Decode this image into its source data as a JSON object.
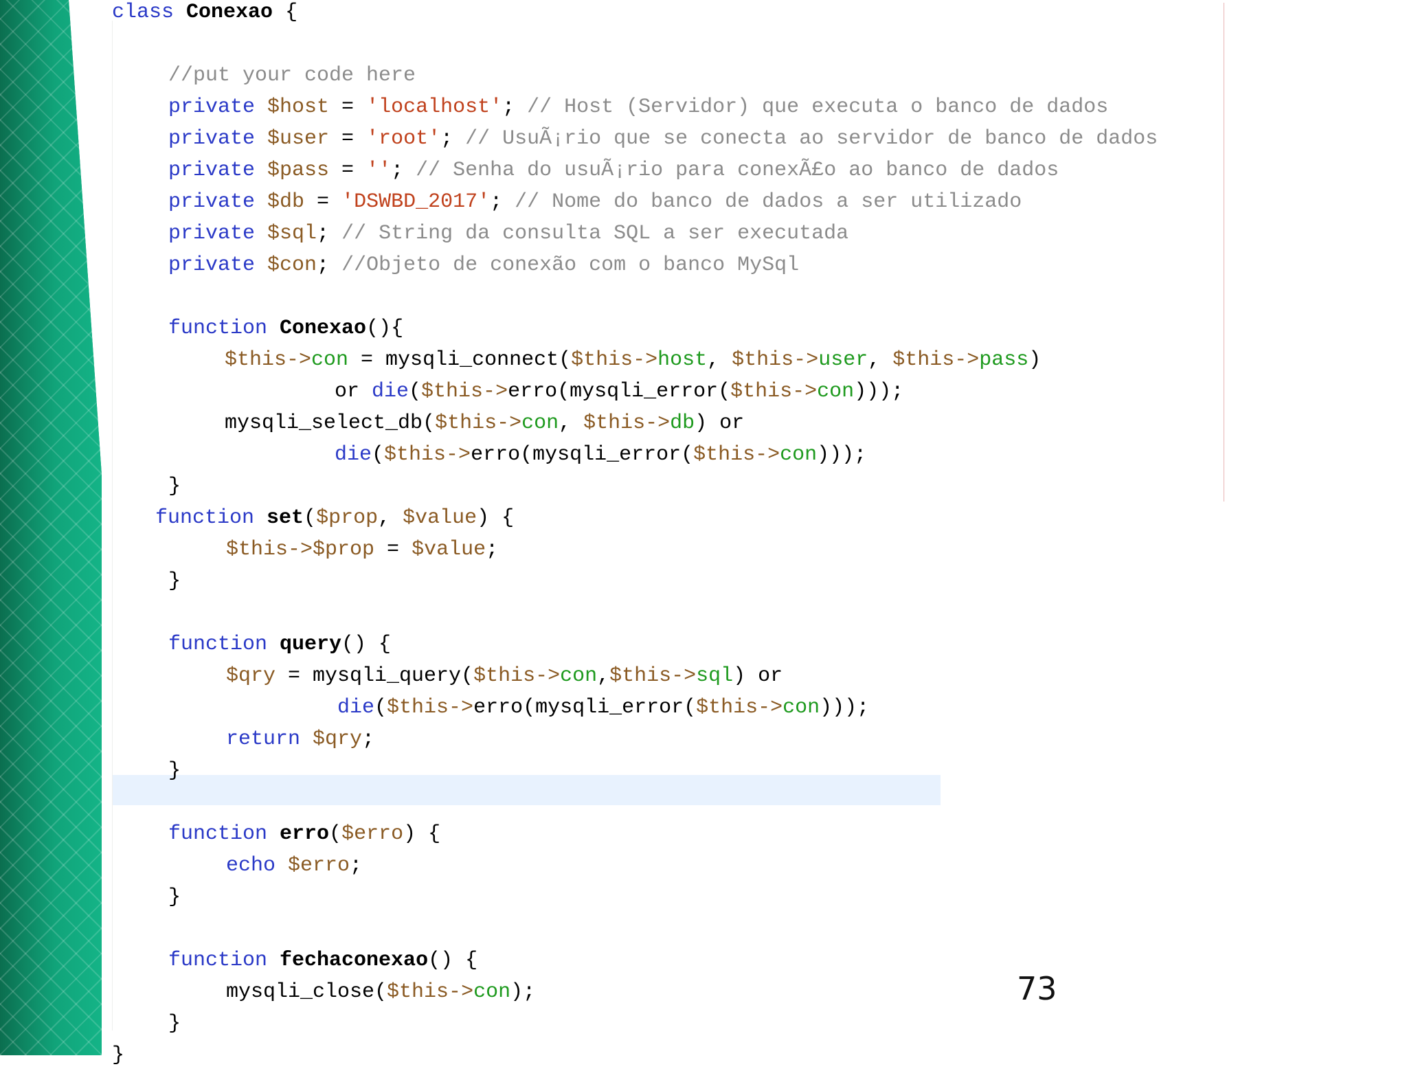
{
  "slide_number": "73",
  "colors": {
    "keyword": "#2a39c7",
    "variable": "#8a5a23",
    "string": "#c0411c",
    "property": "#1e9a1e",
    "comment": "#8b8b8b",
    "background_band": "#0f8a63"
  },
  "code_lines": [
    [
      {
        "t": "kw",
        "v": "class "
      },
      {
        "t": "ty",
        "v": "Conexao"
      },
      {
        "t": "pl",
        "v": " {"
      }
    ],
    [],
    [
      {
        "t": "cm",
        "v": "//put your code here"
      }
    ],
    [
      {
        "t": "kw",
        "v": "private "
      },
      {
        "t": "vr",
        "v": "$host"
      },
      {
        "t": "pl",
        "v": " = "
      },
      {
        "t": "st",
        "v": "'localhost'"
      },
      {
        "t": "pl",
        "v": "; "
      },
      {
        "t": "cm",
        "v": "// Host (Servidor) que executa o banco de dados"
      }
    ],
    [
      {
        "t": "kw",
        "v": "private "
      },
      {
        "t": "vr",
        "v": "$user"
      },
      {
        "t": "pl",
        "v": " = "
      },
      {
        "t": "st",
        "v": "'root'"
      },
      {
        "t": "pl",
        "v": "; "
      },
      {
        "t": "cm",
        "v": "// UsuÃ¡rio que se conecta ao servidor de banco de dados"
      }
    ],
    [
      {
        "t": "kw",
        "v": "private "
      },
      {
        "t": "vr",
        "v": "$pass"
      },
      {
        "t": "pl",
        "v": " = "
      },
      {
        "t": "st",
        "v": "''"
      },
      {
        "t": "pl",
        "v": "; "
      },
      {
        "t": "cm",
        "v": "// Senha do usuÃ¡rio para conexÃ£o ao banco de dados"
      }
    ],
    [
      {
        "t": "kw",
        "v": "private "
      },
      {
        "t": "vr",
        "v": "$db"
      },
      {
        "t": "pl",
        "v": " = "
      },
      {
        "t": "st",
        "v": "'DSWBD_2017'"
      },
      {
        "t": "pl",
        "v": "; "
      },
      {
        "t": "cm",
        "v": "// Nome do banco de dados a ser utilizado"
      }
    ],
    [
      {
        "t": "kw",
        "v": "private "
      },
      {
        "t": "vr",
        "v": "$sql"
      },
      {
        "t": "pl",
        "v": "; "
      },
      {
        "t": "cm",
        "v": "// String da consulta SQL a ser executada"
      }
    ],
    [
      {
        "t": "kw",
        "v": "private "
      },
      {
        "t": "vr",
        "v": "$con"
      },
      {
        "t": "pl",
        "v": "; "
      },
      {
        "t": "cm",
        "v": "//Objeto de conexão com o banco MySql"
      }
    ],
    [],
    [
      {
        "t": "kw",
        "v": "function "
      },
      {
        "t": "ty",
        "v": "Conexao"
      },
      {
        "t": "pl",
        "v": "(){"
      }
    ],
    [
      {
        "t": "vr",
        "v": "$this->"
      },
      {
        "t": "pr",
        "v": "con"
      },
      {
        "t": "pl",
        "v": " = mysqli_connect("
      },
      {
        "t": "vr",
        "v": "$this->"
      },
      {
        "t": "pr",
        "v": "host"
      },
      {
        "t": "pl",
        "v": ", "
      },
      {
        "t": "vr",
        "v": "$this->"
      },
      {
        "t": "pr",
        "v": "user"
      },
      {
        "t": "pl",
        "v": ", "
      },
      {
        "t": "vr",
        "v": "$this->"
      },
      {
        "t": "pr",
        "v": "pass"
      },
      {
        "t": "pl",
        "v": ")"
      }
    ],
    [
      {
        "t": "pl",
        "v": "or "
      },
      {
        "t": "kw",
        "v": "die"
      },
      {
        "t": "pl",
        "v": "("
      },
      {
        "t": "vr",
        "v": "$this->"
      },
      {
        "t": "pl",
        "v": "erro(mysqli_error("
      },
      {
        "t": "vr",
        "v": "$this->"
      },
      {
        "t": "pr",
        "v": "con"
      },
      {
        "t": "pl",
        "v": ")));"
      }
    ],
    [
      {
        "t": "pl",
        "v": "mysqli_select_db("
      },
      {
        "t": "vr",
        "v": "$this->"
      },
      {
        "t": "pr",
        "v": "con"
      },
      {
        "t": "pl",
        "v": ", "
      },
      {
        "t": "vr",
        "v": "$this->"
      },
      {
        "t": "pr",
        "v": "db"
      },
      {
        "t": "pl",
        "v": ") or"
      }
    ],
    [
      {
        "t": "kw",
        "v": "die"
      },
      {
        "t": "pl",
        "v": "("
      },
      {
        "t": "vr",
        "v": "$this->"
      },
      {
        "t": "pl",
        "v": "erro(mysqli_error("
      },
      {
        "t": "vr",
        "v": "$this->"
      },
      {
        "t": "pr",
        "v": "con"
      },
      {
        "t": "pl",
        "v": ")));"
      }
    ],
    [
      {
        "t": "pl",
        "v": "}"
      }
    ],
    [
      {
        "t": "kw",
        "v": "function "
      },
      {
        "t": "ty",
        "v": "set"
      },
      {
        "t": "pl",
        "v": "("
      },
      {
        "t": "vr",
        "v": "$prop"
      },
      {
        "t": "pl",
        "v": ", "
      },
      {
        "t": "vr",
        "v": "$value"
      },
      {
        "t": "pl",
        "v": ") {"
      }
    ],
    [
      {
        "t": "vr",
        "v": "$this->$prop"
      },
      {
        "t": "pl",
        "v": " = "
      },
      {
        "t": "vr",
        "v": "$value"
      },
      {
        "t": "pl",
        "v": ";"
      }
    ],
    [
      {
        "t": "pl",
        "v": "}"
      }
    ],
    [],
    [
      {
        "t": "kw",
        "v": "function "
      },
      {
        "t": "ty",
        "v": "query"
      },
      {
        "t": "pl",
        "v": "() {"
      }
    ],
    [
      {
        "t": "vr",
        "v": "$qry"
      },
      {
        "t": "pl",
        "v": " = mysqli_query("
      },
      {
        "t": "vr",
        "v": "$this->"
      },
      {
        "t": "pr",
        "v": "con"
      },
      {
        "t": "pl",
        "v": ","
      },
      {
        "t": "vr",
        "v": "$this->"
      },
      {
        "t": "pr",
        "v": "sql"
      },
      {
        "t": "pl",
        "v": ") or"
      }
    ],
    [
      {
        "t": "kw",
        "v": "die"
      },
      {
        "t": "pl",
        "v": "("
      },
      {
        "t": "vr",
        "v": "$this->"
      },
      {
        "t": "pl",
        "v": "erro(mysqli_error("
      },
      {
        "t": "vr",
        "v": "$this->"
      },
      {
        "t": "pr",
        "v": "con"
      },
      {
        "t": "pl",
        "v": ")));"
      }
    ],
    [
      {
        "t": "kw",
        "v": "return "
      },
      {
        "t": "vr",
        "v": "$qry"
      },
      {
        "t": "pl",
        "v": ";"
      }
    ],
    [
      {
        "t": "pl",
        "v": "}"
      }
    ],
    [],
    [
      {
        "t": "kw",
        "v": "function "
      },
      {
        "t": "ty",
        "v": "erro"
      },
      {
        "t": "pl",
        "v": "("
      },
      {
        "t": "vr",
        "v": "$erro"
      },
      {
        "t": "pl",
        "v": ") {"
      }
    ],
    [
      {
        "t": "kw",
        "v": "echo "
      },
      {
        "t": "vr",
        "v": "$erro"
      },
      {
        "t": "pl",
        "v": ";"
      }
    ],
    [
      {
        "t": "pl",
        "v": "}"
      }
    ],
    [],
    [
      {
        "t": "kw",
        "v": "function "
      },
      {
        "t": "ty",
        "v": "fechaconexao"
      },
      {
        "t": "pl",
        "v": "() {"
      }
    ],
    [
      {
        "t": "pl",
        "v": "mysqli_close("
      },
      {
        "t": "vr",
        "v": "$this->"
      },
      {
        "t": "pr",
        "v": "con"
      },
      {
        "t": "pl",
        "v": ");"
      }
    ],
    [
      {
        "t": "pl",
        "v": "}"
      }
    ],
    [
      {
        "t": "pl",
        "v": "}"
      }
    ]
  ]
}
